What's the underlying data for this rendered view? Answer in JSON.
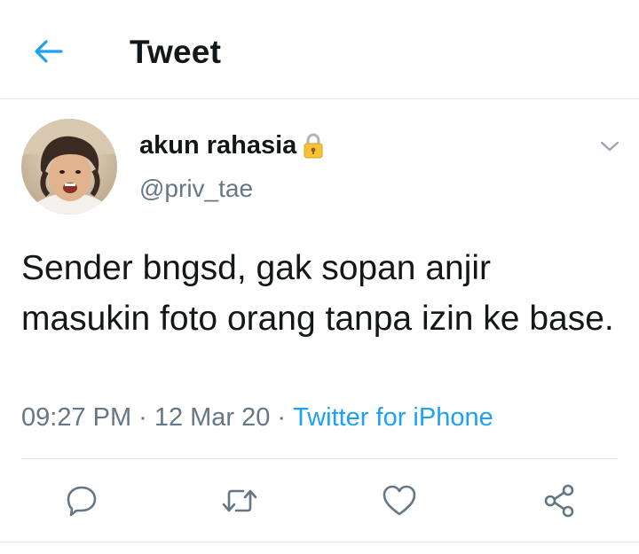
{
  "header": {
    "title": "Tweet",
    "back_icon": "arrow-left-icon",
    "accent_color": "#1da1f2"
  },
  "tweet": {
    "author": {
      "display_name": "akun rahasia",
      "badge_icon": "lock-icon",
      "username": "@priv_tae"
    },
    "text": "Sender bngsd, gak sopan anjir masukin foto orang tanpa izin ke base.",
    "meta": {
      "time": "09:27 PM",
      "separator": "·",
      "date": "12 Mar 20",
      "source": "Twitter for iPhone"
    }
  },
  "actions": [
    {
      "name": "reply",
      "icon": "reply-icon"
    },
    {
      "name": "retweet",
      "icon": "retweet-icon"
    },
    {
      "name": "like",
      "icon": "heart-icon"
    },
    {
      "name": "share",
      "icon": "share-icon"
    }
  ],
  "colors": {
    "text": "#14171a",
    "muted": "#657786",
    "link": "#1da1f2",
    "divider": "#e1e8ed"
  }
}
